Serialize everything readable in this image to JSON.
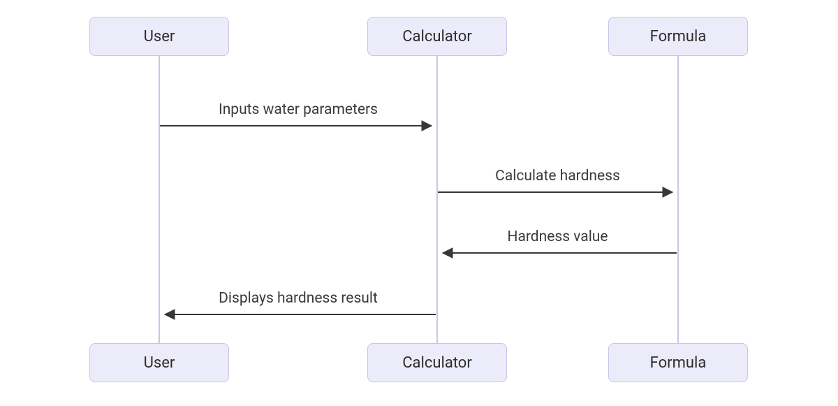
{
  "diagram": {
    "type": "sequence",
    "participants": [
      {
        "id": "user",
        "label": "User"
      },
      {
        "id": "calculator",
        "label": "Calculator"
      },
      {
        "id": "formula",
        "label": "Formula"
      }
    ],
    "bottom_participants": [
      {
        "id": "user",
        "label": "User"
      },
      {
        "id": "calculator",
        "label": "Calculator"
      },
      {
        "id": "formula",
        "label": "Formula"
      }
    ],
    "messages": [
      {
        "from": "user",
        "to": "calculator",
        "label": "Inputs water parameters",
        "direction": "right"
      },
      {
        "from": "calculator",
        "to": "formula",
        "label": "Calculate hardness",
        "direction": "right"
      },
      {
        "from": "formula",
        "to": "calculator",
        "label": "Hardness value",
        "direction": "left"
      },
      {
        "from": "calculator",
        "to": "user",
        "label": "Displays hardness result",
        "direction": "left"
      }
    ]
  },
  "colors": {
    "box_fill": "#ecebfa",
    "box_border": "#c9c5e8",
    "arrow": "#373737"
  }
}
